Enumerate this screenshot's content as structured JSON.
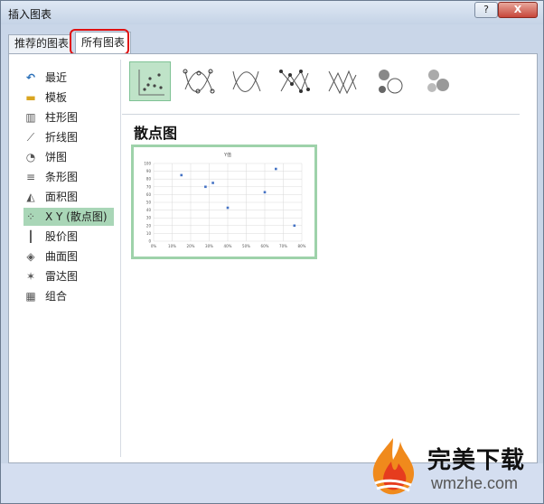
{
  "window": {
    "title": "插入图表",
    "help_label": "?",
    "close_label": "X"
  },
  "tabs": [
    {
      "label": "推荐的图表"
    },
    {
      "label": "所有图表"
    }
  ],
  "sidebar": {
    "items": [
      {
        "label": "最近",
        "icon": "recent-icon"
      },
      {
        "label": "模板",
        "icon": "folder-icon"
      },
      {
        "label": "柱形图",
        "icon": "column-chart-icon"
      },
      {
        "label": "折线图",
        "icon": "line-chart-icon"
      },
      {
        "label": "饼图",
        "icon": "pie-chart-icon"
      },
      {
        "label": "条形图",
        "icon": "bar-chart-icon"
      },
      {
        "label": "面积图",
        "icon": "area-chart-icon"
      },
      {
        "label": "X Y (散点图)",
        "icon": "scatter-chart-icon"
      },
      {
        "label": "股价图",
        "icon": "stock-chart-icon"
      },
      {
        "label": "曲面图",
        "icon": "surface-chart-icon"
      },
      {
        "label": "雷达图",
        "icon": "radar-chart-icon"
      },
      {
        "label": "组合",
        "icon": "combo-chart-icon"
      }
    ],
    "selected_index": 7
  },
  "subtypes": {
    "items": [
      "scatter-icon",
      "scatter-smooth-lines-markers-icon",
      "scatter-smooth-lines-icon",
      "scatter-straight-lines-markers-icon",
      "scatter-straight-lines-icon",
      "bubble-icon",
      "bubble-3d-icon"
    ],
    "selected_index": 0
  },
  "chart_type_title": "散点图",
  "preview_chart": {
    "chart_data": {
      "type": "scatter",
      "title": "Y值",
      "x": [
        0.15,
        0.28,
        0.32,
        0.4,
        0.6,
        0.66,
        0.76
      ],
      "y": [
        85,
        70,
        75,
        43,
        63,
        93,
        20
      ],
      "xlim": [
        0,
        0.8
      ],
      "ylim": [
        0,
        100
      ],
      "xticks": [
        "0%",
        "10%",
        "20%",
        "30%",
        "40%",
        "50%",
        "60%",
        "70%",
        "80%"
      ],
      "yticks": [
        "0",
        "10",
        "20",
        "30",
        "40",
        "50",
        "60",
        "70",
        "80",
        "90",
        "100"
      ],
      "grid": true,
      "marker_color": "#4472c4"
    }
  },
  "watermark": {
    "text": "完美下载",
    "sub": "wmzhe.com"
  },
  "colors": {
    "selected": "#a9d6b7",
    "highlight_border": "#e01010",
    "preview_border": "#9ed2aa"
  }
}
